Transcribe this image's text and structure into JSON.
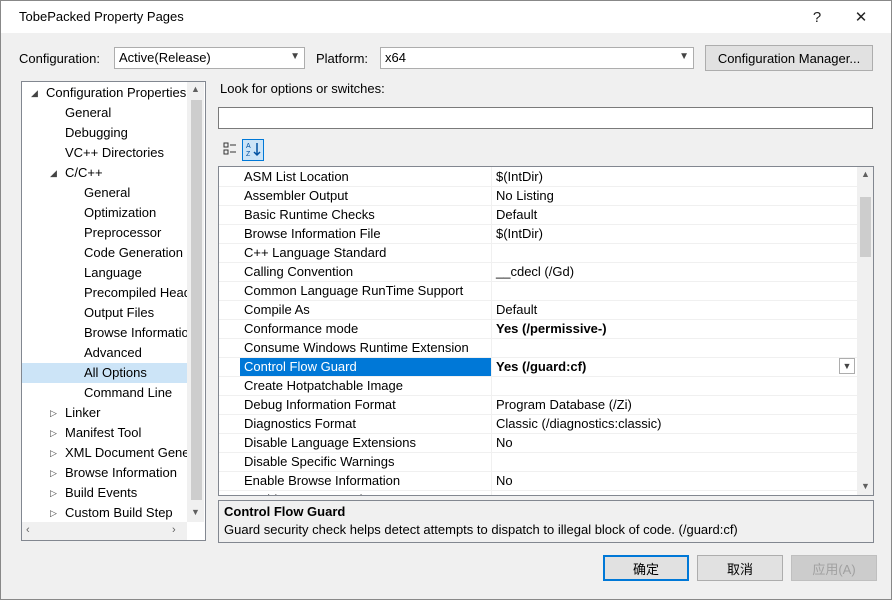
{
  "window": {
    "title": "TobePacked Property Pages",
    "help_glyph": "?",
    "close_glyph": "✕"
  },
  "config": {
    "config_label": "Configuration:",
    "config_value": "Active(Release)",
    "platform_label": "Platform:",
    "platform_value": "x64",
    "manager_button": "Configuration Manager..."
  },
  "tree": {
    "items": [
      {
        "label": "Configuration Properties",
        "expander": "◢"
      },
      {
        "label": "General"
      },
      {
        "label": "Debugging"
      },
      {
        "label": "VC++ Directories"
      },
      {
        "label": "C/C++",
        "expander": "◢"
      },
      {
        "label": "General"
      },
      {
        "label": "Optimization"
      },
      {
        "label": "Preprocessor"
      },
      {
        "label": "Code Generation"
      },
      {
        "label": "Language"
      },
      {
        "label": "Precompiled Head"
      },
      {
        "label": "Output Files"
      },
      {
        "label": "Browse Informatio"
      },
      {
        "label": "Advanced"
      },
      {
        "label": "All Options"
      },
      {
        "label": "Command Line"
      },
      {
        "label": "Linker",
        "expander": "▷"
      },
      {
        "label": "Manifest Tool",
        "expander": "▷"
      },
      {
        "label": "XML Document Gene",
        "expander": "▷"
      },
      {
        "label": "Browse Information",
        "expander": "▷"
      },
      {
        "label": "Build Events",
        "expander": "▷"
      },
      {
        "label": "Custom Build Step",
        "expander": "▷"
      }
    ]
  },
  "search": {
    "label": "Look for options or switches:",
    "value": ""
  },
  "toolbar": {
    "categorized_icon": "categorized-icon",
    "alphabetical_icon": "sort-az-icon"
  },
  "options": [
    {
      "name": "ASM List Location",
      "value": "$(IntDir)"
    },
    {
      "name": "Assembler Output",
      "value": "No Listing"
    },
    {
      "name": "Basic Runtime Checks",
      "value": "Default"
    },
    {
      "name": "Browse Information File",
      "value": "$(IntDir)"
    },
    {
      "name": "C++ Language Standard",
      "value": ""
    },
    {
      "name": "Calling Convention",
      "value": "__cdecl (/Gd)"
    },
    {
      "name": "Common Language RunTime Support",
      "value": ""
    },
    {
      "name": "Compile As",
      "value": "Default"
    },
    {
      "name": "Conformance mode",
      "value": "Yes (/permissive-)",
      "bold": true
    },
    {
      "name": "Consume Windows Runtime Extension",
      "value": ""
    },
    {
      "name": "Control Flow Guard",
      "value": "Yes (/guard:cf)",
      "bold": true,
      "selected": true
    },
    {
      "name": "Create Hotpatchable Image",
      "value": ""
    },
    {
      "name": "Debug Information Format",
      "value": "Program Database (/Zi)"
    },
    {
      "name": "Diagnostics Format",
      "value": "Classic (/diagnostics:classic)"
    },
    {
      "name": "Disable Language Extensions",
      "value": "No"
    },
    {
      "name": "Disable Specific Warnings",
      "value": ""
    },
    {
      "name": "Enable Browse Information",
      "value": "No"
    },
    {
      "name": "Enable Error Reporting",
      "value": "Not Net"
    }
  ],
  "description": {
    "title": "Control Flow Guard",
    "text": "Guard security check helps detect attempts to dispatch to illegal block of code. (/guard:cf)"
  },
  "buttons": {
    "ok": "确定",
    "cancel": "取消",
    "apply": "应用(A)"
  },
  "colors": {
    "selection": "#0078d7",
    "tree_selection": "#cce4f7"
  }
}
